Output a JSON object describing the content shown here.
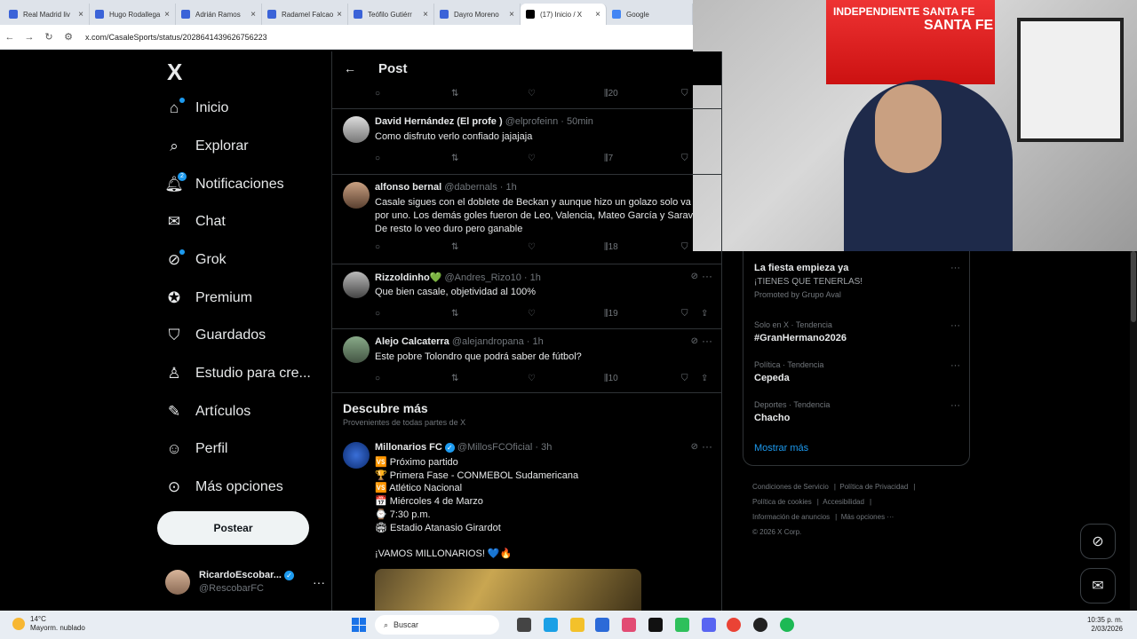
{
  "browser": {
    "tabs": [
      {
        "label": "Real Madrid liv"
      },
      {
        "label": "Hugo Rodallega"
      },
      {
        "label": "Adrián Ramos"
      },
      {
        "label": "Radamel Falcao"
      },
      {
        "label": "Teófilo Gutiérr"
      },
      {
        "label": "Dayro Moreno"
      },
      {
        "label": "(17) Inicio / X"
      },
      {
        "label": "Google"
      }
    ],
    "url": "x.com/CasaleSports/status/2028641439626756223"
  },
  "webcam": {
    "banner_text_1": "INDEPENDIENTE SANTA FE",
    "banner_text_2": "SANTA FE"
  },
  "leftnav": {
    "logo": "X",
    "items": [
      {
        "label": "Inicio"
      },
      {
        "label": "Explorar"
      },
      {
        "label": "Notificaciones",
        "badge": "2"
      },
      {
        "label": "Chat"
      },
      {
        "label": "Grok"
      },
      {
        "label": "Premium"
      },
      {
        "label": "Guardados"
      },
      {
        "label": "Estudio para cre..."
      },
      {
        "label": "Artículos"
      },
      {
        "label": "Perfil"
      },
      {
        "label": "Más opciones"
      }
    ],
    "post_button": "Postear",
    "account": {
      "name": "RicardoEscobar...",
      "handle": "@RescobarFC"
    }
  },
  "main": {
    "header_title": "Post",
    "top_views": "20",
    "replies": [
      {
        "name": "David Hernández (El profe )",
        "handle": "@elprofeinn",
        "time": "· 50min",
        "text": "Como disfruto verlo confiado jajajaja",
        "views": "7"
      },
      {
        "name": "alfonso bernal",
        "handle": "@dabernals",
        "time": "· 1h",
        "text": "Casale sigues con el doblete de Beckan y aunque hizo un golazo solo va\npor uno. Los demás goles fueron de Leo, Valencia, Mateo García y Sarav\nDe resto lo veo duro pero ganable",
        "views": "18"
      },
      {
        "name": "Rizzoldinho💚",
        "handle": "@Andres_Rizo10",
        "time": "· 1h",
        "text": "Que bien casale, objetividad al 100%",
        "views": "19"
      },
      {
        "name": "Alejo Calcaterra",
        "handle": "@alejandropana",
        "time": "· 1h",
        "text": "Este pobre Tolondro que podrá saber de fútbol?",
        "views": "10"
      }
    ],
    "discover_title": "Descubre más",
    "discover_sub": "Provenientes de todas partes de X",
    "promo_tweet": {
      "name": "Millonarios FC",
      "handle": "@MillosFCOficial",
      "time": "· 3h",
      "text": "🆚 Próximo partido\n🏆 Primera Fase - CONMEBOL Sudamericana\n🆚 Atlético Nacional\n📅 Miércoles 4 de Marzo\n⌚ 7:30 p.m.\n🏟 Estadio Atanasio Girardot\n\n¡VAMOS MILLONARIOS! 💙🔥"
    }
  },
  "right": {
    "promo": {
      "title": "La fiesta empieza ya",
      "sub": "¡TIENES QUE TENERLAS!",
      "promoted": "Promoted by Grupo Aval"
    },
    "trends": [
      {
        "category": "Solo en X · Tendencia",
        "name": "#GranHermano2026"
      },
      {
        "category": "Política · Tendencia",
        "name": "Cepeda"
      },
      {
        "category": "Deportes · Tendencia",
        "name": "Chacho"
      }
    ],
    "show_more": "Mostrar más",
    "footer": {
      "l1": "Condiciones de Servicio",
      "l2": "Política de Privacidad",
      "l3": "Política de cookies",
      "l4": "Accesibilidad",
      "l5": "Información de anuncios",
      "l6": "Más opciones ···",
      "l7": "© 2026 X Corp."
    }
  },
  "taskbar": {
    "temp": "14°C",
    "weather": "Mayorm. nublado",
    "search": "Buscar",
    "time": "10:35 p. m.",
    "date": "2/03/2026"
  }
}
